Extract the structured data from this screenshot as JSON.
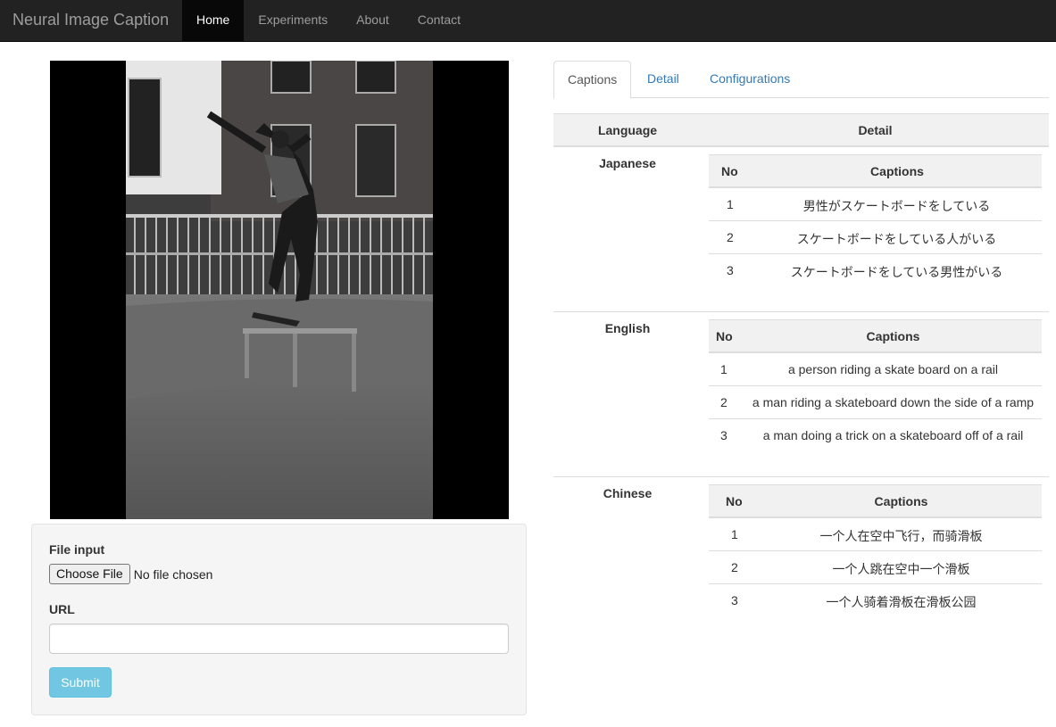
{
  "navbar": {
    "brand": "Neural Image Caption",
    "items": [
      {
        "label": "Home",
        "active": true
      },
      {
        "label": "Experiments",
        "active": false
      },
      {
        "label": "About",
        "active": false
      },
      {
        "label": "Contact",
        "active": false
      }
    ]
  },
  "form": {
    "file_label": "File input",
    "file_button": "Choose File",
    "file_status": "No file chosen",
    "url_label": "URL",
    "url_value": "",
    "submit_label": "Submit"
  },
  "tabs": [
    {
      "label": "Captions",
      "active": true
    },
    {
      "label": "Detail",
      "active": false
    },
    {
      "label": "Configurations",
      "active": false
    }
  ],
  "results": {
    "header": {
      "language": "Language",
      "detail": "Detail"
    },
    "inner_header": {
      "no": "No",
      "captions": "Captions"
    },
    "languages": [
      {
        "name": "Japanese",
        "captions": [
          {
            "no": "1",
            "text": "男性がスケートボードをしている"
          },
          {
            "no": "2",
            "text": "スケートボードをしている人がいる"
          },
          {
            "no": "3",
            "text": "スケートボードをしている男性がいる"
          }
        ]
      },
      {
        "name": "English",
        "captions": [
          {
            "no": "1",
            "text": "a person riding a skate board on a rail"
          },
          {
            "no": "2",
            "text": "a man riding a skateboard down the side of a ramp"
          },
          {
            "no": "3",
            "text": "a man doing a trick on a skateboard off of a rail"
          }
        ]
      },
      {
        "name": "Chinese",
        "captions": [
          {
            "no": "1",
            "text": "一个人在空中飞行，而骑滑板"
          },
          {
            "no": "2",
            "text": "一个人跳在空中一个滑板"
          },
          {
            "no": "3",
            "text": "一个人骑着滑板在滑板公园"
          }
        ]
      }
    ]
  }
}
